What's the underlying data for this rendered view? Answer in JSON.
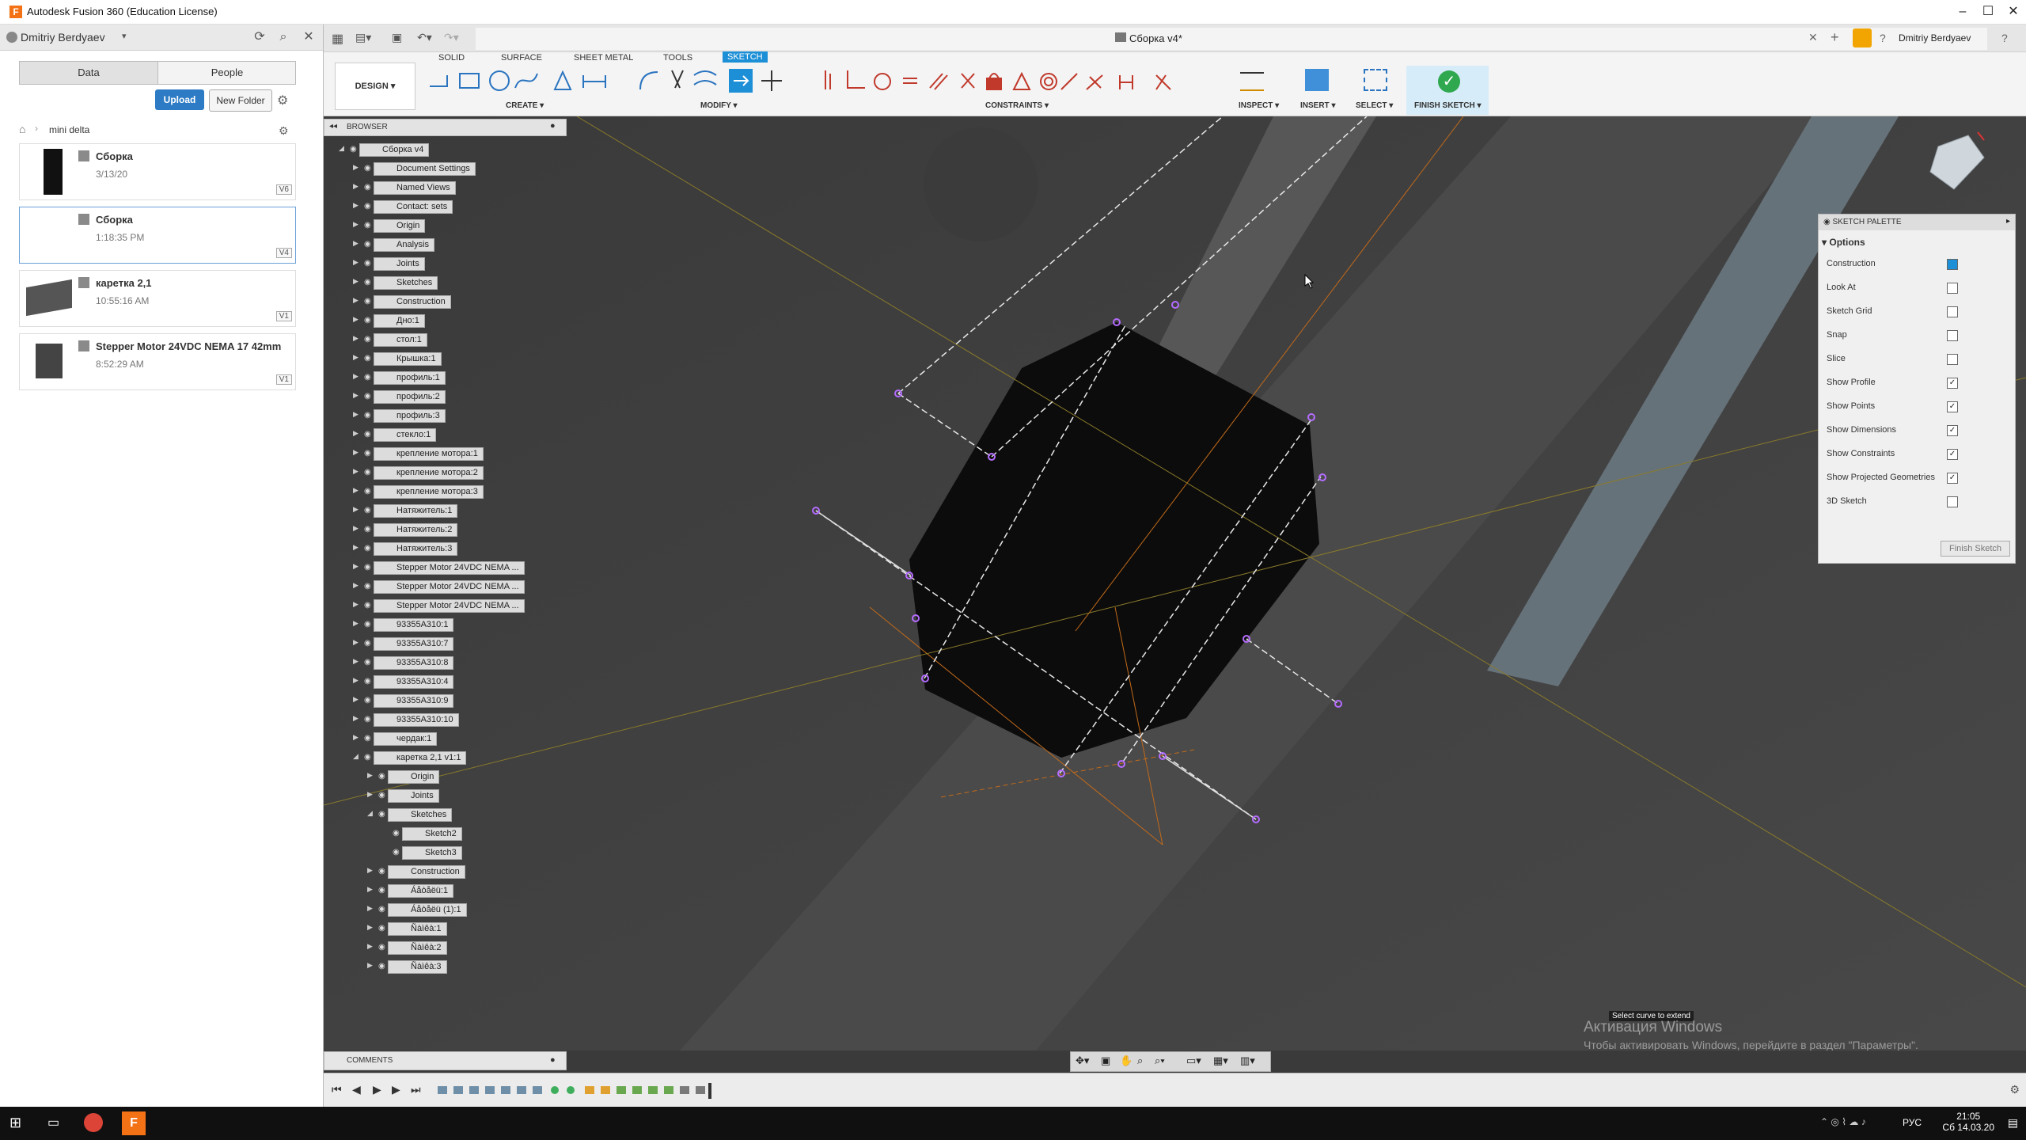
{
  "window": {
    "title": "Autodesk Fusion 360 (Education License)"
  },
  "user": {
    "name": "Dmitriy Berdyaev",
    "name_short": "Dmitriy Berdyaev"
  },
  "data_panel": {
    "tabs": [
      "Data",
      "People"
    ],
    "upload": "Upload",
    "new_folder": "New Folder",
    "breadcrumb": "mini delta",
    "files": [
      {
        "name": "Сборка",
        "date": "3/13/20",
        "version": "V6"
      },
      {
        "name": "Сборка",
        "date": "1:18:35 PM",
        "version": "V4"
      },
      {
        "name": "каретка 2,1",
        "date": "10:55:16 AM",
        "version": "V1"
      },
      {
        "name": "Stepper Motor 24VDC NEMA 17 42mm",
        "date": "8:52:29 AM",
        "version": "V1"
      }
    ]
  },
  "document": {
    "title": "Сборка v4*"
  },
  "toolbar": {
    "design": "DESIGN",
    "tabs": [
      "SOLID",
      "SURFACE",
      "SHEET METAL",
      "TOOLS",
      "SKETCH"
    ],
    "groups": [
      "CREATE",
      "MODIFY",
      "CONSTRAINTS",
      "INSPECT",
      "INSERT",
      "SELECT",
      "FINISH SKETCH"
    ]
  },
  "browser": {
    "title": "BROWSER",
    "nodes": [
      "Сборка v4",
      "Document Settings",
      "Named Views",
      "Contact: sets",
      "Origin",
      "Analysis",
      "Joints",
      "Sketches",
      "Construction",
      "Дно:1",
      "стол:1",
      "Крышка:1",
      "профиль:1",
      "профиль:2",
      "профиль:3",
      "стекло:1",
      "крепление мотора:1",
      "крепление мотора:2",
      "крепление мотора:3",
      "Натяжитель:1",
      "Натяжитель:2",
      "Натяжитель:3",
      "Stepper Motor 24VDC NEMA ...",
      "Stepper Motor 24VDC NEMA ...",
      "Stepper Motor 24VDC NEMA ...",
      "93355A310:1",
      "93355A310:7",
      "93355A310:8",
      "93355A310:4",
      "93355A310:9",
      "93355A310:10",
      "чердак:1",
      "каретка 2,1 v1:1"
    ],
    "child_nodes": [
      "Origin",
      "Joints",
      "Sketches",
      "Sketch2",
      "Sketch3",
      "Construction",
      "Áåòåëü:1",
      "Áåòåëü (1):1",
      "Ñàìêà:1",
      "Ñàìêà:2",
      "Ñàìêà:3"
    ]
  },
  "palette": {
    "title": "SKETCH PALETTE",
    "section": "Options",
    "rows": [
      {
        "label": "Construction",
        "checked": ""
      },
      {
        "label": "Look At",
        "checked": ""
      },
      {
        "label": "Sketch Grid",
        "checked": ""
      },
      {
        "label": "Snap",
        "checked": ""
      },
      {
        "label": "Slice",
        "checked": ""
      },
      {
        "label": "Show Profile",
        "checked": "✓"
      },
      {
        "label": "Show Points",
        "checked": "✓"
      },
      {
        "label": "Show Dimensions",
        "checked": "✓"
      },
      {
        "label": "Show Constraints",
        "checked": "✓"
      },
      {
        "label": "Show Projected Geometries",
        "checked": "✓"
      },
      {
        "label": "3D Sketch",
        "checked": ""
      }
    ],
    "finish": "Finish Sketch"
  },
  "viewport": {
    "tooltip": "Select curve to extend",
    "watermark_title": "Активация Windows",
    "watermark_text": "Чтобы активировать Windows, перейдите в раздел \"Параметры\"."
  },
  "comments": {
    "title": "COMMENTS"
  },
  "taskbar": {
    "time": "21:05",
    "date": "Сб 14.03.20",
    "lang": "РУС"
  },
  "colors": {
    "accent": "#1d8fd6",
    "finish": "#2fa84f",
    "fusion": "#f47216"
  }
}
